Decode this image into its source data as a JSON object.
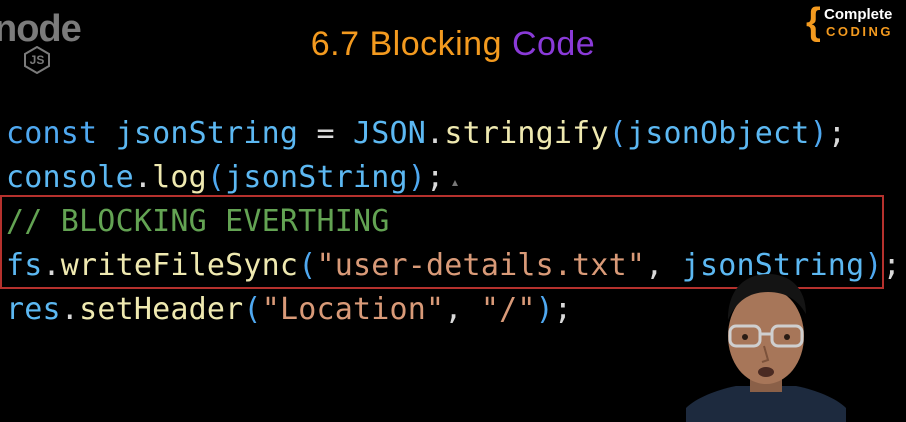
{
  "logo": {
    "word": "node",
    "badge": "JS"
  },
  "title": {
    "main": "6.7 Blocking ",
    "accent": "Code"
  },
  "brand": {
    "brace": "{",
    "line1": "Complete",
    "line2": "CODING"
  },
  "code": {
    "line1": {
      "kw": "const ",
      "name": "jsonString",
      "eq": " = ",
      "obj": "JSON",
      "dot": ".",
      "fn": "stringify",
      "open": "(",
      "arg": "jsonObject",
      "close": ")",
      "end": ";"
    },
    "line2": {
      "obj": "console",
      "dot": ".",
      "fn": "log",
      "open": "(",
      "arg": "jsonString",
      "close": ")",
      "end": ";"
    },
    "line3": {
      "comment": "// BLOCKING EVERTHING"
    },
    "line4": {
      "obj": "fs",
      "dot": ".",
      "fn": "writeFileSync",
      "open": "(",
      "str": "\"user-details.txt\"",
      "comma": ", ",
      "arg": "jsonString",
      "close": ")",
      "end": ";"
    },
    "line5": {
      "obj": "res",
      "dot": ".",
      "fn": "setHeader",
      "open": "(",
      "str1": "\"Location\"",
      "comma": ", ",
      "str2": "\"/\"",
      "close": ")",
      "end": ";"
    }
  },
  "colors": {
    "title_orange": "#f39a1f",
    "title_purple": "#8a3ad8",
    "keyword_blue": "#4fa8f0",
    "function_yellow": "#efe9b0",
    "string_orange": "#d99a78",
    "comment_green": "#63a353",
    "highlight_red": "#b5312d"
  }
}
